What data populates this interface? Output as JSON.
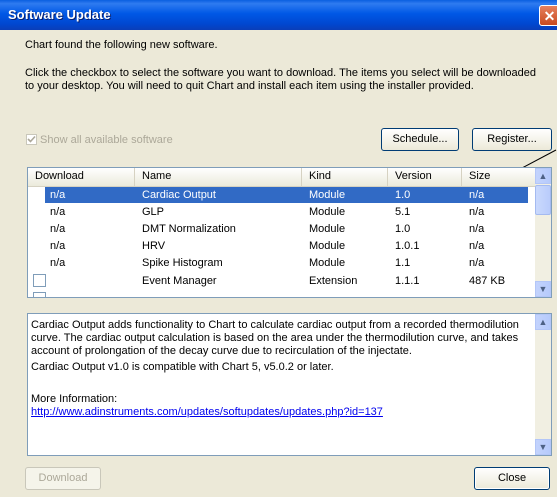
{
  "window": {
    "title": "Software Update",
    "close_symbol": "✕"
  },
  "intro": "Chart found the following new software.",
  "instructions": "Click the checkbox to select the software you want to download. The items you select will be downloaded to your desktop. You will need to quit Chart and install each item using the installer provided.",
  "show_all": {
    "label": "Show all available software",
    "checked": true,
    "disabled": true
  },
  "buttons": {
    "schedule": "Schedule...",
    "register": "Register...",
    "download": "Download",
    "close": "Close"
  },
  "list": {
    "columns": [
      "Download",
      "Name",
      "Kind",
      "Version",
      "Size"
    ],
    "rows": [
      {
        "download": "n/a",
        "name": "Cardiac Output",
        "kind": "Module",
        "version": "1.0",
        "size": "n/a",
        "selected": true
      },
      {
        "download": "n/a",
        "name": "GLP",
        "kind": "Module",
        "version": "5.1",
        "size": "n/a"
      },
      {
        "download": "n/a",
        "name": "DMT Normalization",
        "kind": "Module",
        "version": "1.0",
        "size": "n/a"
      },
      {
        "download": "n/a",
        "name": "HRV",
        "kind": "Module",
        "version": "1.0.1",
        "size": "n/a"
      },
      {
        "download": "n/a",
        "name": "Spike Histogram",
        "kind": "Module",
        "version": "1.1",
        "size": "n/a"
      },
      {
        "download": "",
        "name": "Event Manager",
        "kind": "Extension",
        "version": "1.1.1",
        "size": "487 KB",
        "checkbox": true
      }
    ]
  },
  "description": {
    "para1": "Cardiac Output adds functionality to Chart to calculate cardiac output from a recorded thermodilution curve. The cardiac output calculation is based on the area under the thermodilution curve, and takes account of prolongation of the decay curve due to recirculation of the injectate.",
    "para2": "Cardiac Output v1.0 is compatible with Chart 5, v5.0.2 or later.",
    "more_label": "More Information:",
    "more_link": "http://www.adinstruments.com/updates/softupdates/updates.php?id=137"
  },
  "icons": {
    "scroll_up": "up-arrow-icon",
    "scroll_down": "down-arrow-icon",
    "check": "checkmark-icon",
    "close": "close-icon"
  }
}
